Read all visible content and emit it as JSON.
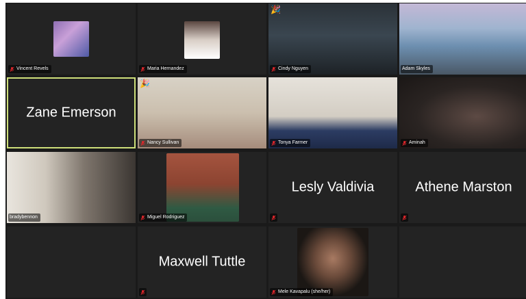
{
  "participants": [
    {
      "id": "p1",
      "name": "Vincent Revels",
      "display": "",
      "muted": true
    },
    {
      "id": "p2",
      "name": "Maria Hernandez",
      "display": "",
      "muted": true
    },
    {
      "id": "p3",
      "name": "Cindy Nguyen",
      "display": "",
      "muted": true,
      "reaction": "🎉"
    },
    {
      "id": "p4",
      "name": "Adam Skyles",
      "display": "",
      "muted": false
    },
    {
      "id": "p5",
      "name": "",
      "display": "Zane Emerson",
      "muted": false,
      "active": true
    },
    {
      "id": "p6",
      "name": "Nancy Sullivan",
      "display": "",
      "muted": true,
      "reaction": "🎉"
    },
    {
      "id": "p7",
      "name": "Tonya Farmer",
      "display": "",
      "muted": true
    },
    {
      "id": "p8",
      "name": "Aminah",
      "display": "",
      "muted": true
    },
    {
      "id": "p9",
      "name": "bradybennon",
      "display": "",
      "muted": false
    },
    {
      "id": "p10",
      "name": "Miguel Rodriguez",
      "display": "",
      "muted": true
    },
    {
      "id": "p11",
      "name": "",
      "display": "Lesly Valdivia",
      "muted": true
    },
    {
      "id": "p12",
      "name": "",
      "display": "Athene Marston",
      "muted": true
    },
    {
      "id": "p13",
      "name": "",
      "display": "",
      "muted": false
    },
    {
      "id": "p14",
      "name": "",
      "display": "Maxwell Tuttle",
      "muted": true
    },
    {
      "id": "p15",
      "name": "Mele Kavapalu (she/her)",
      "display": "",
      "muted": true
    },
    {
      "id": "p16",
      "name": "",
      "display": "",
      "muted": false
    }
  ],
  "colors": {
    "tile_bg": "#232323",
    "active_border": "#cfe07a",
    "mute_icon": "#e0262b"
  }
}
